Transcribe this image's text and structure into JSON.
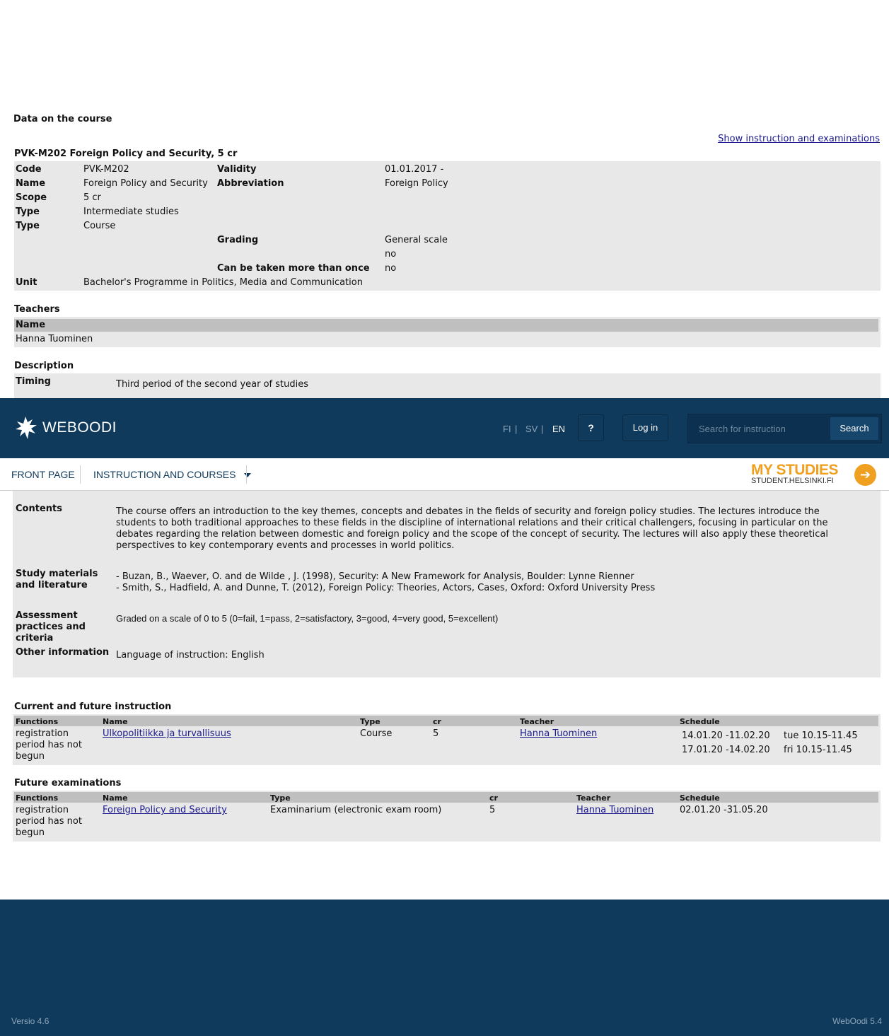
{
  "course": {
    "section_title": "Data on the course",
    "show_instruction_link": "Show instruction and examinations",
    "heading": "PVK-M202 Foreign Policy and Security, 5 cr",
    "fields": {
      "code_label": "Code",
      "code": "PVK-M202",
      "validity_label": "Validity",
      "validity": "01.01.2017 -",
      "name_label": "Name",
      "name": "Foreign Policy and Security",
      "abbreviation_label": "Abbreviation",
      "abbreviation": "Foreign Policy",
      "scope_label": "Scope",
      "scope": "5 cr",
      "type1_label": "Type",
      "type1": "Intermediate studies",
      "type2_label": "Type",
      "type2": "Course",
      "grading_label": "Grading",
      "grading": "General scale",
      "grading_extra": "no",
      "repeat_label": "Can be taken more than once",
      "repeat": "no",
      "unit_label": "Unit",
      "unit": "Bachelor's Programme in Politics, Media and Communication"
    }
  },
  "teachers": {
    "title": "Teachers",
    "header_name": "Name",
    "names": [
      "Hanna Tuominen"
    ]
  },
  "description": {
    "title": "Description",
    "timing_label": "Timing",
    "timing": "Third period of the second year of studies",
    "contents_label": "Contents",
    "contents": "The course offers an introduction to the key themes, concepts and debates in the fields of security and foreign policy studies. The lectures introduce the students to both traditional approaches to these fields in the discipline of international relations and their critical challengers, focusing in particular on the debates regarding the relation between domestic and foreign policy and the scope of the concept of security. The lectures will also apply these theoretical perspectives to key contemporary events and processes in world politics.",
    "materials_label": "Study materials and literature",
    "materials": [
      "- Buzan, B., Waever, O. and de Wilde , J. (1998), Security: A New Framework for Analysis, Boulder: Lynne Rienner",
      "- Smith, S., Hadfield, A. and Dunne, T. (2012), Foreign Policy: Theories, Actors, Cases, Oxford: Oxford University Press"
    ],
    "assessment_label": "Assessment practices and criteria",
    "assessment": "Graded on a scale of 0 to 5 (0=fail, 1=pass, 2=satisfactory, 3=good, 4=very good, 5=excellent)",
    "other_label": "Other information",
    "other": "Language of instruction: English"
  },
  "header": {
    "logo": "WEBOODI",
    "langs": [
      "FI",
      "SV",
      "EN"
    ],
    "help": "?",
    "login": "Log in",
    "search_placeholder": "Search for instruction",
    "search_button": "Search"
  },
  "nav": {
    "front_page": "FRONT PAGE",
    "instruction": "INSTRUCTION AND COURSES",
    "my_studies": "MY STUDIES",
    "my_studies_sub": "STUDENT.HELSINKI.FI"
  },
  "instruction": {
    "title": "Current and future instruction",
    "headers": [
      "Functions",
      "Name",
      "Type",
      "cr",
      "Teacher",
      "Schedule"
    ],
    "row": {
      "functions": "registration period has not begun",
      "name": "Ulkopolitiikka ja turvallisuus",
      "type": "Course",
      "cr": "5",
      "teacher": "Hanna Tuominen",
      "schedule": [
        {
          "dates": "14.01.20 -11.02.20",
          "time": "tue 10.15-11.45"
        },
        {
          "dates": "17.01.20 -14.02.20",
          "time": "fri 10.15-11.45"
        }
      ]
    }
  },
  "exams": {
    "title": "Future examinations",
    "headers": [
      "Functions",
      "Name",
      "Type",
      "cr",
      "Teacher",
      "Schedule"
    ],
    "row": {
      "functions": "registration period has not begun",
      "name": "Foreign Policy and Security",
      "type": "Examinarium (electronic exam room)",
      "cr": "5",
      "teacher": "Hanna Tuominen",
      "schedule": "02.01.20 -31.05.20"
    }
  },
  "footer": {
    "version_left": "Versio 4.6",
    "version_right": "WebOodi 5.4"
  }
}
